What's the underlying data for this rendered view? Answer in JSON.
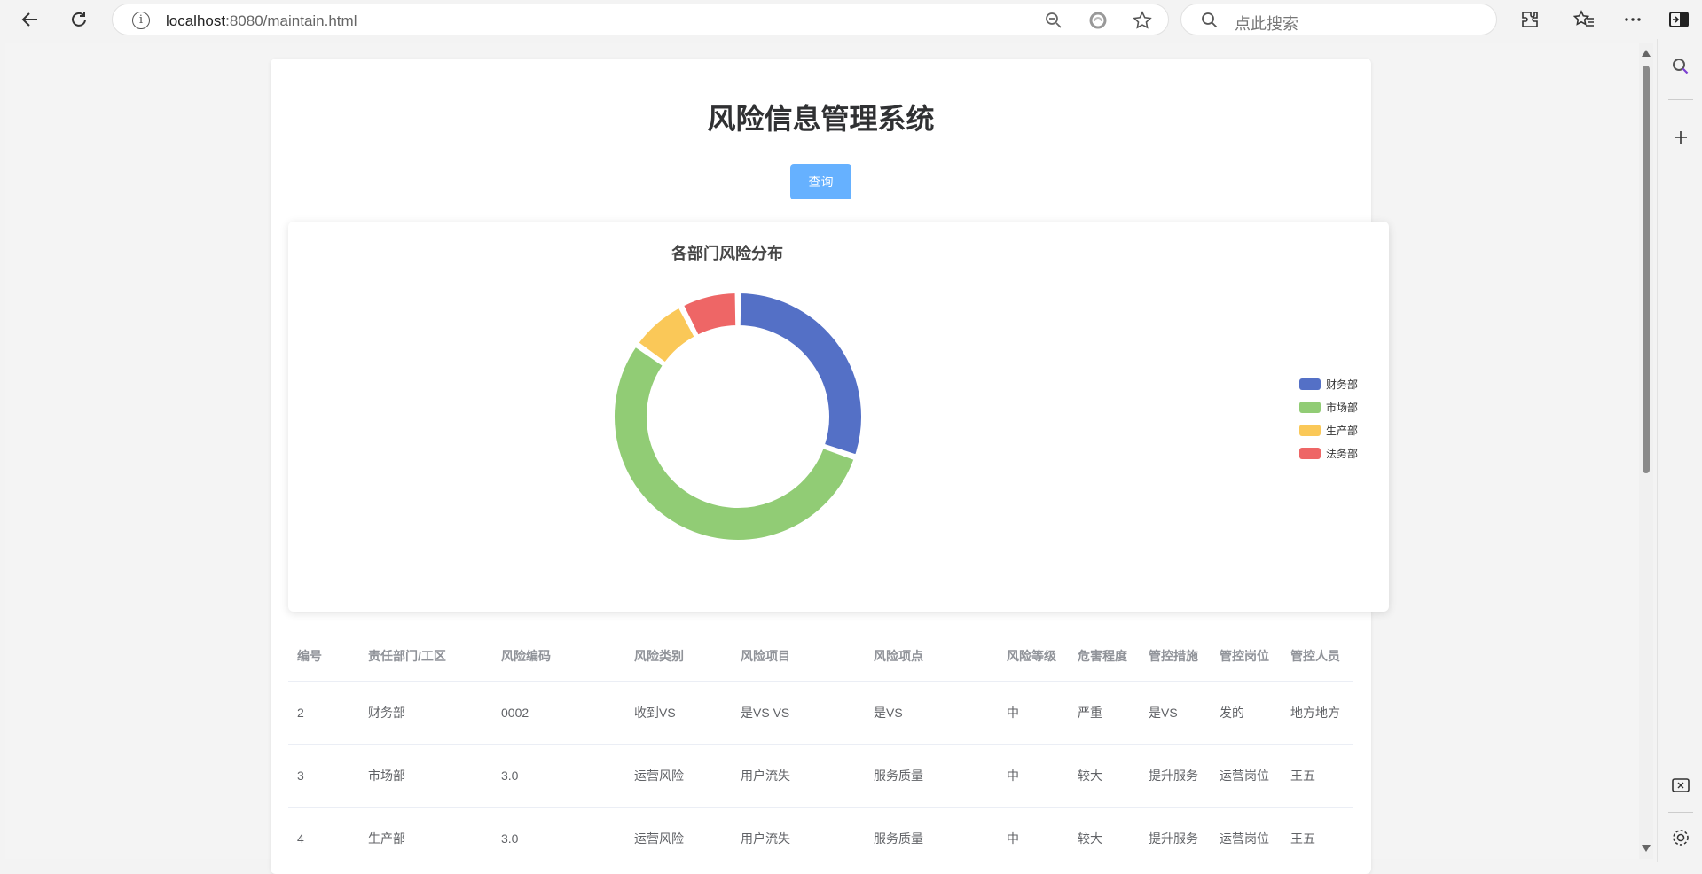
{
  "browser": {
    "url_host": "localhost",
    "url_rest": ":8080/maintain.html",
    "search_placeholder": "点此搜索"
  },
  "page": {
    "title": "风险信息管理系统",
    "query_button": "查询"
  },
  "chart_data": {
    "type": "pie",
    "title": "各部门风险分布",
    "categories": [
      "财务部",
      "市场部",
      "生产部",
      "法务部"
    ],
    "values": [
      1,
      1.8,
      0.25,
      0.25
    ],
    "colors": [
      "#5470c6",
      "#91cc75",
      "#fac858",
      "#ee6666"
    ],
    "legend_position": "right"
  },
  "table": {
    "headers": [
      "编号",
      "责任部门/工区",
      "风险编码",
      "风险类别",
      "风险项目",
      "风险项点",
      "风险等级",
      "危害程度",
      "管控措施",
      "管控岗位",
      "管控人员"
    ],
    "rows": [
      [
        "2",
        "财务部",
        "0002",
        "收到VS",
        "是VS VS",
        "是VS",
        "中",
        "严重",
        "是VS",
        "发的",
        "地方地方"
      ],
      [
        "3",
        "市场部",
        "3.0",
        "运营风险",
        "用户流失",
        "服务质量",
        "中",
        "较大",
        "提升服务",
        "运营岗位",
        "王五"
      ],
      [
        "4",
        "生产部",
        "3.0",
        "运营风险",
        "用户流失",
        "服务质量",
        "中",
        "较大",
        "提升服务",
        "运营岗位",
        "王五"
      ]
    ]
  }
}
